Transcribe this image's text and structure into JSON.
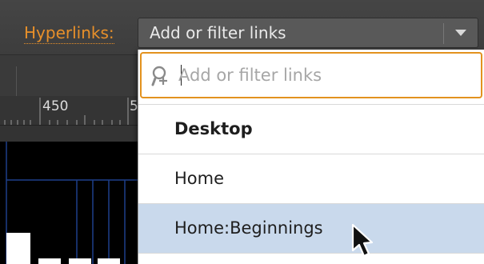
{
  "properties": {
    "hyperlinks_label": "Hyperlinks:",
    "combo_value": "Add or filter links"
  },
  "ruler": {
    "label": "450",
    "next_label": "5"
  },
  "dropdown": {
    "search_placeholder": "Add or filter links",
    "group_header": "Desktop",
    "items": [
      {
        "label": "Home",
        "selected": false
      },
      {
        "label": "Home:Beginnings",
        "selected": true
      }
    ]
  },
  "colors": {
    "accent": "#e8902a",
    "selection": "#c9d9ec"
  },
  "icons": [
    "add-link-search-icon",
    "chevron-down-icon",
    "mouse-pointer-icon"
  ]
}
